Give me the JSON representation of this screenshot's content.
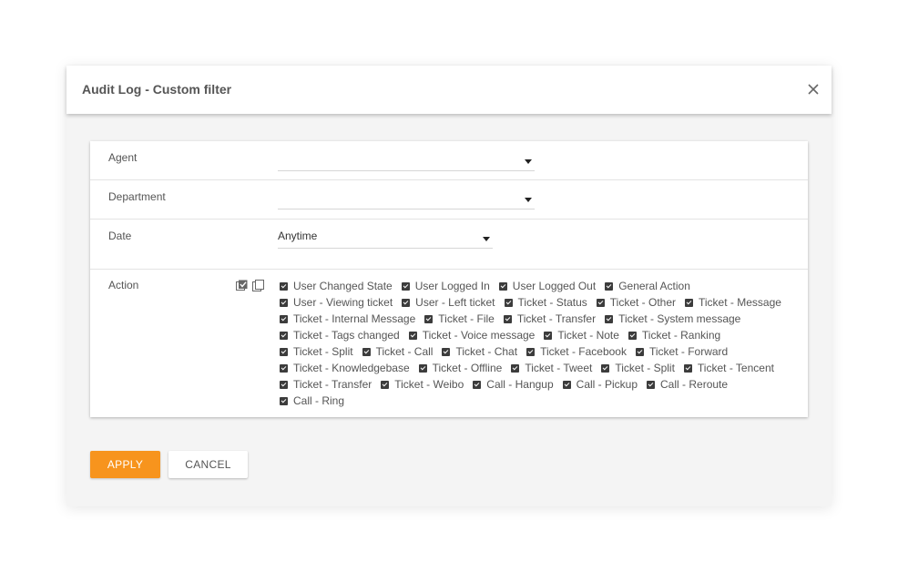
{
  "dialog": {
    "title": "Audit Log - Custom filter",
    "close_icon": "close-icon"
  },
  "filters": {
    "agent": {
      "label": "Agent",
      "value": ""
    },
    "department": {
      "label": "Department",
      "value": ""
    },
    "date": {
      "label": "Date",
      "value": "Anytime"
    },
    "action": {
      "label": "Action",
      "tools": [
        "select-all-icon",
        "copy-icon"
      ],
      "items": [
        "User   Changed State",
        "User   Logged In",
        "User   Logged Out",
        "General Action",
        "User - Viewing ticket",
        "User - Left ticket",
        "Ticket - Status",
        "Ticket - Other",
        "Ticket - Message",
        "Ticket - Internal Message",
        "Ticket - File",
        "Ticket - Transfer",
        "Ticket - System message",
        "Ticket - Tags changed",
        "Ticket - Voice message",
        "Ticket - Note",
        "Ticket - Ranking",
        "Ticket - Split",
        "Ticket - Call",
        "Ticket - Chat",
        "Ticket - Facebook",
        "Ticket - Forward",
        "Ticket - Knowledgebase",
        "Ticket - Offline",
        "Ticket - Tweet",
        "Ticket - Split",
        "Ticket - Tencent",
        "Ticket - Transfer",
        "Ticket - Weibo",
        "Call - Hangup",
        "Call - Pickup",
        "Call - Reroute",
        "Call - Ring"
      ]
    }
  },
  "buttons": {
    "apply": "APPLY",
    "cancel": "CANCEL"
  },
  "colors": {
    "accent": "#f7941d",
    "checkbox": "#3c3c3c"
  }
}
